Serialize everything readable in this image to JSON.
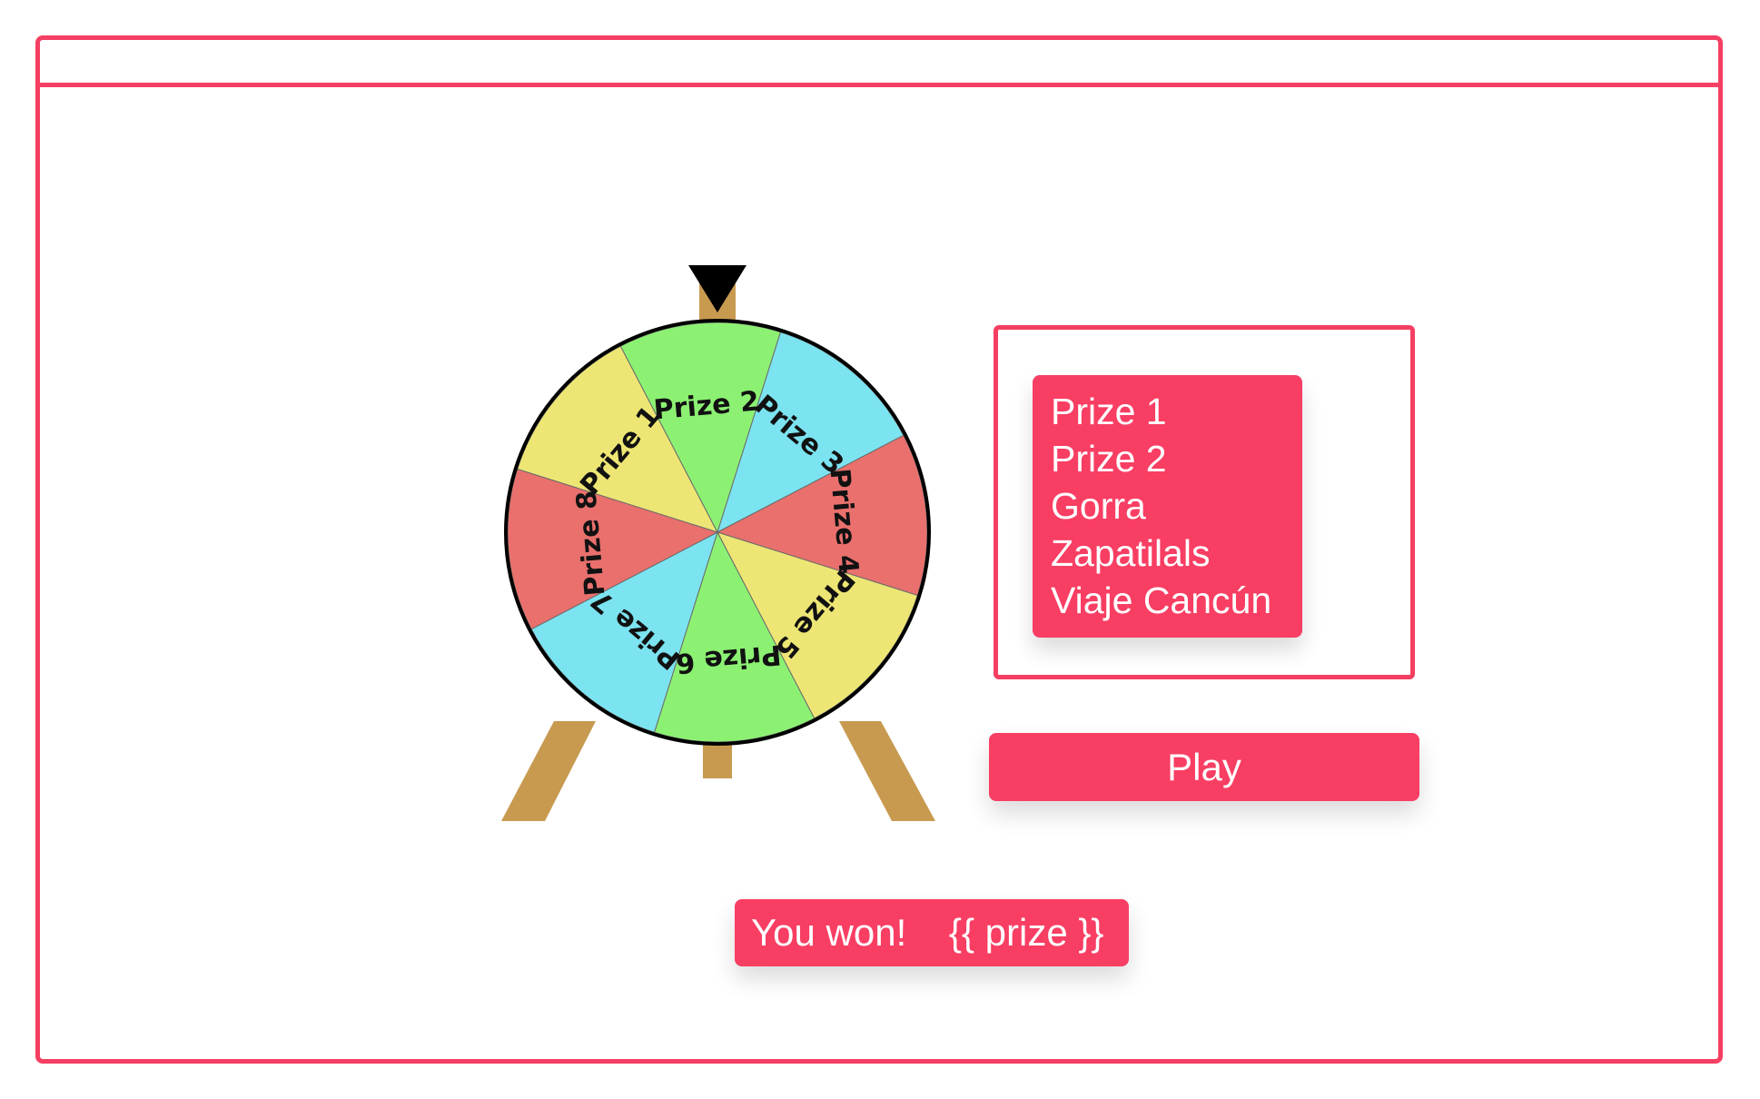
{
  "wheel": {
    "segments": [
      {
        "label": "Prize 1",
        "color": "#ede674"
      },
      {
        "label": "Prize 2",
        "color": "#8cf173"
      },
      {
        "label": "Prize 3",
        "color": "#7ce3f0"
      },
      {
        "label": "Prize 4",
        "color": "#e9706d"
      },
      {
        "label": "Prize 5",
        "color": "#ede674"
      },
      {
        "label": "Prize 6",
        "color": "#8cf173"
      },
      {
        "label": "Prize 7",
        "color": "#7ce3f0"
      },
      {
        "label": "Prize 8",
        "color": "#e9706d"
      }
    ],
    "stand_color": "#c79a50",
    "pointer_color": "#000000"
  },
  "prize_list": {
    "items": [
      "Prize 1",
      "Prize 2",
      "Gorra",
      "Zapatilals",
      "Viaje Cancún"
    ]
  },
  "play_button": {
    "label": "Play"
  },
  "result": {
    "text": "You won!    {{ prize }}"
  },
  "theme": {
    "accent": "#f83e63",
    "border": "#f43f62"
  }
}
